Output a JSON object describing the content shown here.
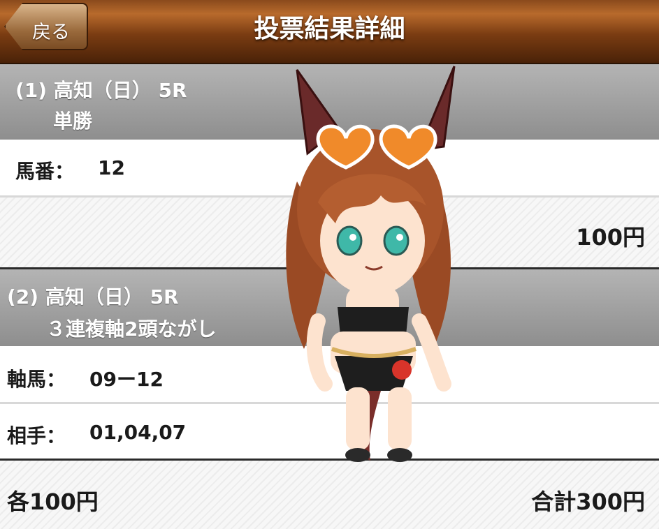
{
  "header": {
    "back_label": "戻る",
    "title": "投票結果詳細"
  },
  "bets": [
    {
      "race_label": "(1) 高知（日） 5R",
      "bet_type": "単勝",
      "selections": [
        {
          "label": "馬番：",
          "value": "12"
        }
      ],
      "amount": "100円"
    },
    {
      "race_label": "(2) 高知（日） 5R",
      "bet_type": "３連複軸2頭ながし",
      "selections": [
        {
          "label": "軸馬：",
          "value": "09ー12"
        },
        {
          "label": "相手：",
          "value": "01,04,07"
        }
      ],
      "per_unit": "各100円",
      "total": "合計300円"
    }
  ],
  "colors": {
    "header_brown": "#7a3c12",
    "race_header_gray": "#9e9e9e",
    "hair": "#a8542a",
    "eyes": "#3fb8a8"
  }
}
